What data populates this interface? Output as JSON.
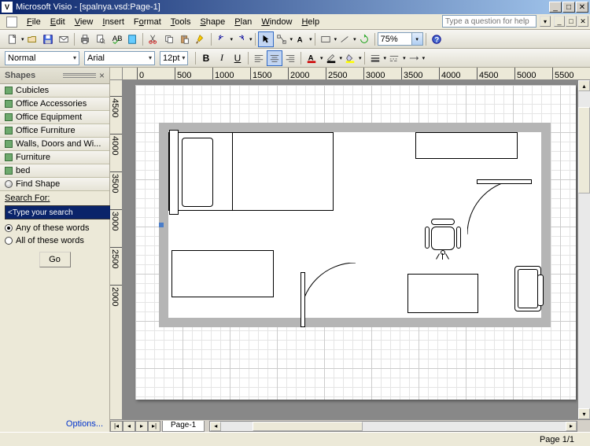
{
  "app": {
    "title": "Microsoft Visio - [spalnya.vsd:Page-1]"
  },
  "menu": {
    "items": [
      "File",
      "Edit",
      "View",
      "Insert",
      "Format",
      "Tools",
      "Shape",
      "Plan",
      "Window",
      "Help"
    ],
    "help_placeholder": "Type a question for help"
  },
  "toolbar": {
    "zoom": "75%"
  },
  "format": {
    "style": "Normal",
    "font": "Arial",
    "size": "12pt"
  },
  "shapes": {
    "title": "Shapes",
    "items": [
      "Cubicles",
      "Office Accessories",
      "Office Equipment",
      "Office Furniture",
      "Walls, Doors and Wi...",
      "Furniture",
      "bed"
    ],
    "find_shape": "Find Shape",
    "search_label": "Search For:",
    "search_value": "<Type your search",
    "radio_any": "Any of these words",
    "radio_all": "All of these words",
    "go": "Go",
    "options": "Options..."
  },
  "ruler_h": [
    "0",
    "500",
    "1000",
    "1500",
    "2000",
    "2500",
    "3000",
    "3500",
    "4000",
    "4500",
    "5000",
    "5500"
  ],
  "ruler_v": [
    "4500",
    "4000",
    "3500",
    "3000",
    "2500",
    "2000"
  ],
  "tabs": {
    "page1": "Page-1"
  },
  "status": {
    "page": "Page 1/1"
  }
}
